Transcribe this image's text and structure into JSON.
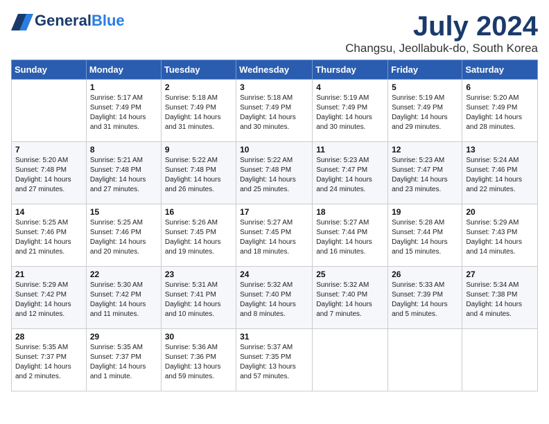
{
  "logo": {
    "general": "General",
    "blue": "Blue",
    "icon_title": "GeneralBlue logo"
  },
  "title": {
    "month_year": "July 2024",
    "location": "Changsu, Jeollabuk-do, South Korea"
  },
  "weekdays": [
    "Sunday",
    "Monday",
    "Tuesday",
    "Wednesday",
    "Thursday",
    "Friday",
    "Saturday"
  ],
  "weeks": [
    [
      {
        "day": "",
        "info": ""
      },
      {
        "day": "1",
        "info": "Sunrise: 5:17 AM\nSunset: 7:49 PM\nDaylight: 14 hours\nand 31 minutes."
      },
      {
        "day": "2",
        "info": "Sunrise: 5:18 AM\nSunset: 7:49 PM\nDaylight: 14 hours\nand 31 minutes."
      },
      {
        "day": "3",
        "info": "Sunrise: 5:18 AM\nSunset: 7:49 PM\nDaylight: 14 hours\nand 30 minutes."
      },
      {
        "day": "4",
        "info": "Sunrise: 5:19 AM\nSunset: 7:49 PM\nDaylight: 14 hours\nand 30 minutes."
      },
      {
        "day": "5",
        "info": "Sunrise: 5:19 AM\nSunset: 7:49 PM\nDaylight: 14 hours\nand 29 minutes."
      },
      {
        "day": "6",
        "info": "Sunrise: 5:20 AM\nSunset: 7:49 PM\nDaylight: 14 hours\nand 28 minutes."
      }
    ],
    [
      {
        "day": "7",
        "info": "Sunrise: 5:20 AM\nSunset: 7:48 PM\nDaylight: 14 hours\nand 27 minutes."
      },
      {
        "day": "8",
        "info": "Sunrise: 5:21 AM\nSunset: 7:48 PM\nDaylight: 14 hours\nand 27 minutes."
      },
      {
        "day": "9",
        "info": "Sunrise: 5:22 AM\nSunset: 7:48 PM\nDaylight: 14 hours\nand 26 minutes."
      },
      {
        "day": "10",
        "info": "Sunrise: 5:22 AM\nSunset: 7:48 PM\nDaylight: 14 hours\nand 25 minutes."
      },
      {
        "day": "11",
        "info": "Sunrise: 5:23 AM\nSunset: 7:47 PM\nDaylight: 14 hours\nand 24 minutes."
      },
      {
        "day": "12",
        "info": "Sunrise: 5:23 AM\nSunset: 7:47 PM\nDaylight: 14 hours\nand 23 minutes."
      },
      {
        "day": "13",
        "info": "Sunrise: 5:24 AM\nSunset: 7:46 PM\nDaylight: 14 hours\nand 22 minutes."
      }
    ],
    [
      {
        "day": "14",
        "info": "Sunrise: 5:25 AM\nSunset: 7:46 PM\nDaylight: 14 hours\nand 21 minutes."
      },
      {
        "day": "15",
        "info": "Sunrise: 5:25 AM\nSunset: 7:46 PM\nDaylight: 14 hours\nand 20 minutes."
      },
      {
        "day": "16",
        "info": "Sunrise: 5:26 AM\nSunset: 7:45 PM\nDaylight: 14 hours\nand 19 minutes."
      },
      {
        "day": "17",
        "info": "Sunrise: 5:27 AM\nSunset: 7:45 PM\nDaylight: 14 hours\nand 18 minutes."
      },
      {
        "day": "18",
        "info": "Sunrise: 5:27 AM\nSunset: 7:44 PM\nDaylight: 14 hours\nand 16 minutes."
      },
      {
        "day": "19",
        "info": "Sunrise: 5:28 AM\nSunset: 7:44 PM\nDaylight: 14 hours\nand 15 minutes."
      },
      {
        "day": "20",
        "info": "Sunrise: 5:29 AM\nSunset: 7:43 PM\nDaylight: 14 hours\nand 14 minutes."
      }
    ],
    [
      {
        "day": "21",
        "info": "Sunrise: 5:29 AM\nSunset: 7:42 PM\nDaylight: 14 hours\nand 12 minutes."
      },
      {
        "day": "22",
        "info": "Sunrise: 5:30 AM\nSunset: 7:42 PM\nDaylight: 14 hours\nand 11 minutes."
      },
      {
        "day": "23",
        "info": "Sunrise: 5:31 AM\nSunset: 7:41 PM\nDaylight: 14 hours\nand 10 minutes."
      },
      {
        "day": "24",
        "info": "Sunrise: 5:32 AM\nSunset: 7:40 PM\nDaylight: 14 hours\nand 8 minutes."
      },
      {
        "day": "25",
        "info": "Sunrise: 5:32 AM\nSunset: 7:40 PM\nDaylight: 14 hours\nand 7 minutes."
      },
      {
        "day": "26",
        "info": "Sunrise: 5:33 AM\nSunset: 7:39 PM\nDaylight: 14 hours\nand 5 minutes."
      },
      {
        "day": "27",
        "info": "Sunrise: 5:34 AM\nSunset: 7:38 PM\nDaylight: 14 hours\nand 4 minutes."
      }
    ],
    [
      {
        "day": "28",
        "info": "Sunrise: 5:35 AM\nSunset: 7:37 PM\nDaylight: 14 hours\nand 2 minutes."
      },
      {
        "day": "29",
        "info": "Sunrise: 5:35 AM\nSunset: 7:37 PM\nDaylight: 14 hours\nand 1 minute."
      },
      {
        "day": "30",
        "info": "Sunrise: 5:36 AM\nSunset: 7:36 PM\nDaylight: 13 hours\nand 59 minutes."
      },
      {
        "day": "31",
        "info": "Sunrise: 5:37 AM\nSunset: 7:35 PM\nDaylight: 13 hours\nand 57 minutes."
      },
      {
        "day": "",
        "info": ""
      },
      {
        "day": "",
        "info": ""
      },
      {
        "day": "",
        "info": ""
      }
    ]
  ]
}
